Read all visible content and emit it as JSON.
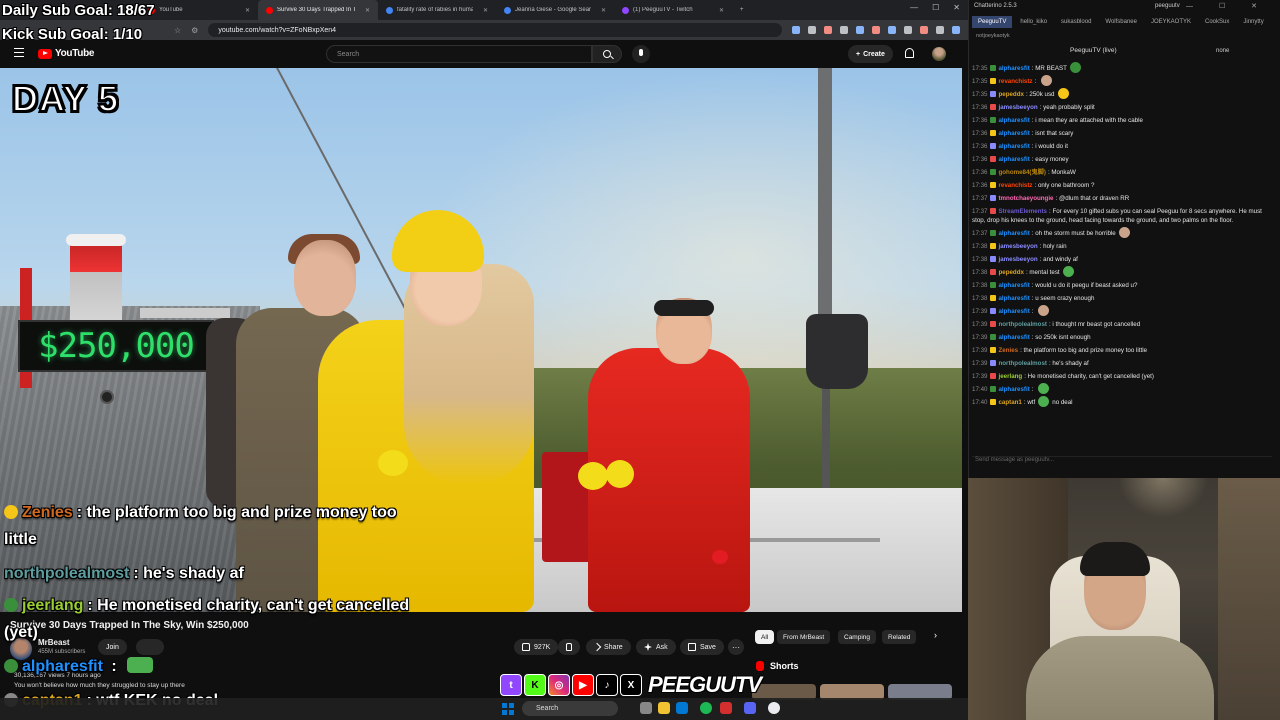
{
  "browser": {
    "tabs": [
      {
        "title": "YouTube",
        "icon": "youtube-icon",
        "active": false
      },
      {
        "title": "Survive 30 Days Trapped In T",
        "icon": "youtube-icon",
        "active": true
      },
      {
        "title": "fatality rate of rabies in humans - Go",
        "icon": "google-icon",
        "active": false
      },
      {
        "title": "Jeanna Giese - Google Search",
        "icon": "google-icon",
        "active": false
      },
      {
        "title": "(1) PeeguuTV - Twitch",
        "icon": "twitch-icon",
        "active": false
      }
    ],
    "new_tab": "+",
    "url": "youtube.com/watch?v=ZFoNBxpXen4"
  },
  "youtube": {
    "logo_text": "YouTube",
    "search_placeholder": "Search",
    "create_label": "Create",
    "video_overlay_text": "DAY 5",
    "video_sign_text": "$250,000",
    "title": "Survive 30 Days Trapped In The Sky, Win $250,000",
    "channel_name": "MrBeast",
    "channel_subs": "455M subscribers",
    "join_label": "Join",
    "likes": "927K",
    "share_label": "Share",
    "ask_label": "Ask",
    "save_label": "Save",
    "more_label": "···",
    "meta": "30,136,167 views  7 hours ago",
    "description": "You won't believe how much they struggled to stay up there",
    "chips": [
      "All",
      "From MrBeast",
      "Camping",
      "Related"
    ],
    "shorts_label": "Shorts"
  },
  "stream_overlay": {
    "sub_goal": "Daily Sub Goal: 18/67",
    "kick_goal": "Kick Sub Goal: 1/10",
    "brand": "PEEGUUTV",
    "socials": [
      "twitch",
      "kick",
      "instagram",
      "youtube",
      "tiktok",
      "x"
    ],
    "chat": [
      {
        "user": "Zenies",
        "color": "#d2691e",
        "text": ": the platform too big and prize money too"
      },
      {
        "user": "",
        "color": "#ffffff",
        "text": "little"
      },
      {
        "user": "northpolealmost",
        "color": "#5f9ea0",
        "text": ": he's shady af"
      },
      {
        "user": "jeerlang",
        "color": "#9acd32",
        "text": ": He monetised charity, can't get cancelled"
      },
      {
        "user": "",
        "color": "#ffffff",
        "text": "(yet)"
      },
      {
        "user": "alpharesfit",
        "color": "#1e90ff",
        "text": " :"
      },
      {
        "user": "captan1",
        "color": "#daa520",
        "text": ": wtf KEK no deal"
      }
    ]
  },
  "taskbar": {
    "search_label": "Search"
  },
  "chatterino": {
    "title": "Chatterino 2.5.3",
    "user": "peeguutv",
    "tabs": [
      "PeeguuTV",
      "hello_kiko",
      "sukasblood",
      "Wolfsbanee",
      "JOEYKAOTYK",
      "CookSux",
      "Jinnytty"
    ],
    "tab_row2": "notjoeykaotyk",
    "channel": "PeeguuTV (live)",
    "mode": "none",
    "input_placeholder": "Send message as peeguutv...",
    "messages": [
      {
        "time": "17:35",
        "user": "alpharesfit",
        "color": "#1e90ff",
        "text": "MR BEAST",
        "emote": "#3a8f3a"
      },
      {
        "time": "17:35",
        "user": "revanchistz",
        "color": "#ff4500",
        "text": "",
        "emote": "#c9a38a"
      },
      {
        "time": "17:35",
        "user": "pepeddx",
        "color": "#daa520",
        "text": "250k usd",
        "emote": "#f5c518"
      },
      {
        "time": "17:36",
        "user": "jamesbeeyon",
        "color": "#8a8aff",
        "text": "yeah probably split"
      },
      {
        "time": "17:36",
        "user": "alpharesfit",
        "color": "#1e90ff",
        "text": "i mean they are attached with the cable"
      },
      {
        "time": "17:36",
        "user": "alpharesfit",
        "color": "#1e90ff",
        "text": "isnt that scary"
      },
      {
        "time": "17:36",
        "user": "alpharesfit",
        "color": "#1e90ff",
        "text": "i would do it"
      },
      {
        "time": "17:36",
        "user": "alpharesfit",
        "color": "#1e90ff",
        "text": "easy money"
      },
      {
        "time": "17:36",
        "user": "gohome84(鬼脚)",
        "color": "#b8860b",
        "text": "MonkaW"
      },
      {
        "time": "17:36",
        "user": "revanchistz",
        "color": "#ff4500",
        "text": "only one bathroom ?"
      },
      {
        "time": "17:37",
        "user": "tmnotchaeyoungie",
        "color": "#ff69b4",
        "text": "@dlum that or draven RR"
      },
      {
        "time": "17:37",
        "user": "StreamElements",
        "color": "#6a5acd",
        "text": "For every 10 gifted subs you can seal Peeguu for 8 secs anywhere. He must stop, drop his knees to the ground, head facing towards the ground, and two palms on the floor.",
        "wrap": true
      },
      {
        "time": "17:37",
        "user": "alpharesfit",
        "color": "#1e90ff",
        "text": "oh the storm must be horrible",
        "emote": "#c9a38a"
      },
      {
        "time": "17:38",
        "user": "jamesbeeyon",
        "color": "#8a8aff",
        "text": "holy rain"
      },
      {
        "time": "17:38",
        "user": "jamesbeeyon",
        "color": "#8a8aff",
        "text": "and windy af"
      },
      {
        "time": "17:38",
        "user": "pepeddx",
        "color": "#daa520",
        "text": "mental test",
        "emote": "#4caf50"
      },
      {
        "time": "17:38",
        "user": "alpharesfit",
        "color": "#1e90ff",
        "text": "would u do it peegu if beast asked u?"
      },
      {
        "time": "17:38",
        "user": "alpharesfit",
        "color": "#1e90ff",
        "text": "u seem crazy enough"
      },
      {
        "time": "17:39",
        "user": "alpharesfit",
        "color": "#1e90ff",
        "text": "",
        "emote": "#c9a38a"
      },
      {
        "time": "17:39",
        "user": "northpolealmost",
        "color": "#5f9ea0",
        "text": "i thought mr beast got cancelled"
      },
      {
        "time": "17:39",
        "user": "alpharesfit",
        "color": "#1e90ff",
        "text": "so 250k isnt enough"
      },
      {
        "time": "17:39",
        "user": "Zenies",
        "color": "#d2691e",
        "text": "the platform too big and prize money too little"
      },
      {
        "time": "17:39",
        "user": "northpolealmost",
        "color": "#5f9ea0",
        "text": "he's shady af"
      },
      {
        "time": "17:39",
        "user": "jeerlang",
        "color": "#9acd32",
        "text": "He monetised charity, can't get cancelled (yet)"
      },
      {
        "time": "17:40",
        "user": "alpharesfit",
        "color": "#1e90ff",
        "text": "",
        "emote": "#4caf50"
      },
      {
        "time": "17:40",
        "user": "captan1",
        "color": "#daa520",
        "text": "wtf",
        "emote": "#4caf50",
        "after": "no deal"
      }
    ]
  },
  "colors": {
    "yt_red": "#ff0000",
    "twitch_purple": "#9146ff",
    "kick_green": "#53fc18",
    "led_green": "#2ee06a"
  }
}
